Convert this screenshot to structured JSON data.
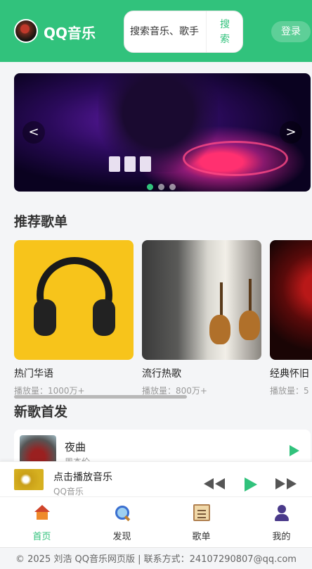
{
  "header": {
    "brand": "QQ音乐",
    "search_placeholder": "搜索音乐、歌手",
    "search_button": "搜\n索",
    "login": "登录"
  },
  "banner": {
    "prev": "<",
    "next": ">",
    "dots": 3,
    "active_dot": 1
  },
  "sections": {
    "playlists_title": "推荐歌单",
    "new_songs_title": "新歌首发"
  },
  "playlists": [
    {
      "name": "热门华语",
      "plays": "播放量：1000万+"
    },
    {
      "name": "流行热歌",
      "plays": "播放量：800万+"
    },
    {
      "name": "经典怀旧",
      "plays": "播放量：5"
    }
  ],
  "new_songs": [
    {
      "title": "夜曲",
      "artist": "周杰伦"
    }
  ],
  "player": {
    "title": "点击播放音乐",
    "artist": "QQ音乐"
  },
  "nav": [
    {
      "label": "首页",
      "icon": "home-icon",
      "active": true
    },
    {
      "label": "发现",
      "icon": "search-icon",
      "active": false
    },
    {
      "label": "歌单",
      "icon": "clipboard-icon",
      "active": false
    },
    {
      "label": "我的",
      "icon": "user-icon",
      "active": false
    }
  ],
  "footer": "© 2025 刘浩 QQ音乐网页版 | 联系方式：24107290807@qq.com",
  "colors": {
    "brand": "#31c27c",
    "background": "#f4f5f7"
  }
}
